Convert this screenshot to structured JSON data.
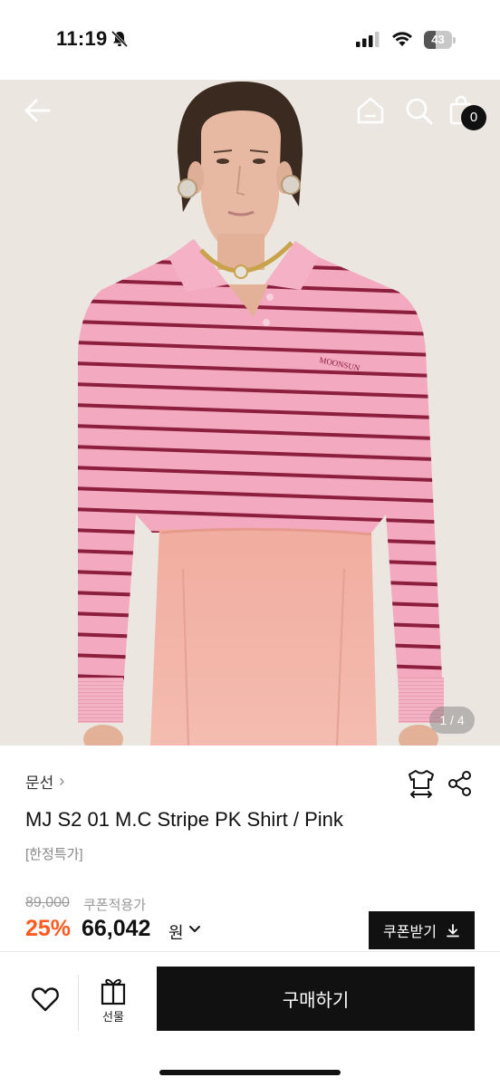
{
  "status_bar": {
    "time": "11:19",
    "battery_level": "43",
    "icons": [
      "bell-slash-icon",
      "cellular-signal-icon",
      "wifi-icon",
      "battery-icon"
    ]
  },
  "top_nav": {
    "icons": [
      "back-arrow-icon",
      "home-icon",
      "search-icon",
      "shopping-bag-icon"
    ],
    "cart_count": "0"
  },
  "gallery": {
    "counter": "1 / 4"
  },
  "product": {
    "brand": "문선",
    "brand_chevron": "›",
    "title": "MJ S2 01 M.C Stripe PK Shirt / Pink",
    "tag": "[한정특가]",
    "original_price": "89,000",
    "coupon_note": "쿠폰적용가",
    "discount_rate": "25%",
    "sale_price": "66,042",
    "currency": "원",
    "coupon_button_label": "쿠폰받기",
    "action_icons": [
      "size-guide-shirt-icon",
      "share-icon"
    ]
  },
  "bottom_bar": {
    "gift_label": "선물",
    "buy_label": "구매하기",
    "icons": [
      "heart-icon",
      "gift-icon"
    ]
  },
  "colors": {
    "accent_discount": "#ff5a1f",
    "primary_button": "#111111",
    "shirt_pink": "#f2a6bd",
    "stripe": "#8a1e3c",
    "skirt_pink": "#f3b4aa"
  }
}
